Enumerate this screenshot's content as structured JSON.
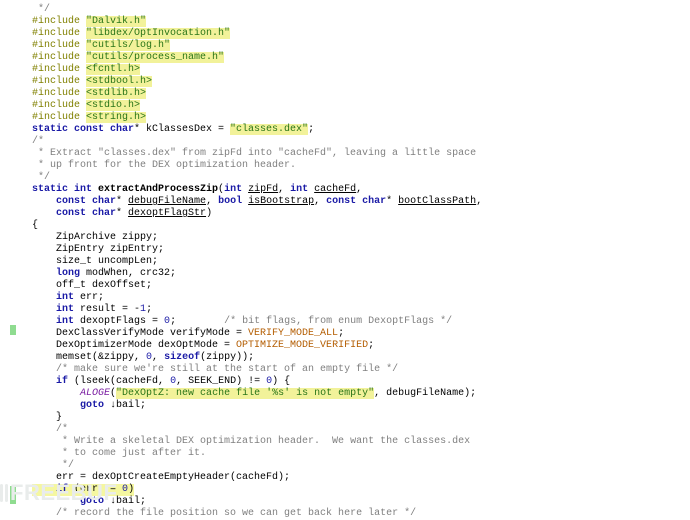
{
  "file": {
    "language": "C",
    "lines": [
      {
        "parts": [
          {
            "c": "cm",
            "t": " */"
          }
        ]
      },
      {
        "parts": [
          {
            "c": "pp",
            "t": "#include "
          },
          {
            "c": "inc",
            "t": "\"Dalvik.h\""
          }
        ]
      },
      {
        "parts": [
          {
            "c": "pp",
            "t": "#include "
          },
          {
            "c": "inc",
            "t": "\"libdex/OptInvocation.h\""
          }
        ]
      },
      {
        "parts": [
          {
            "c": "",
            "t": ""
          }
        ]
      },
      {
        "parts": [
          {
            "c": "pp",
            "t": "#include "
          },
          {
            "c": "inc",
            "t": "\"cutils/log.h\""
          }
        ]
      },
      {
        "parts": [
          {
            "c": "pp",
            "t": "#include "
          },
          {
            "c": "inc",
            "t": "\"cutils/process_name.h\""
          }
        ]
      },
      {
        "parts": [
          {
            "c": "",
            "t": ""
          }
        ]
      },
      {
        "parts": [
          {
            "c": "pp",
            "t": "#include "
          },
          {
            "c": "inc",
            "t": "<fcntl.h>"
          }
        ]
      },
      {
        "parts": [
          {
            "c": "pp",
            "t": "#include "
          },
          {
            "c": "inc",
            "t": "<stdbool.h>"
          }
        ]
      },
      {
        "parts": [
          {
            "c": "pp",
            "t": "#include "
          },
          {
            "c": "inc",
            "t": "<stdlib.h>"
          }
        ]
      },
      {
        "parts": [
          {
            "c": "pp",
            "t": "#include "
          },
          {
            "c": "inc",
            "t": "<stdio.h>"
          }
        ]
      },
      {
        "parts": [
          {
            "c": "pp",
            "t": "#include "
          },
          {
            "c": "inc",
            "t": "<string.h>"
          }
        ]
      },
      {
        "parts": [
          {
            "c": "",
            "t": ""
          }
        ]
      },
      {
        "parts": [
          {
            "c": "kw",
            "t": "static const char"
          },
          {
            "c": "",
            "t": "* kClassesDex = "
          },
          {
            "c": "str",
            "t": "\"classes.dex\""
          },
          {
            "c": "",
            "t": ";"
          }
        ]
      },
      {
        "parts": [
          {
            "c": "",
            "t": ""
          }
        ]
      },
      {
        "parts": [
          {
            "c": "",
            "t": ""
          }
        ]
      },
      {
        "parts": [
          {
            "c": "cm",
            "t": "/*"
          }
        ]
      },
      {
        "parts": [
          {
            "c": "cm",
            "t": " * Extract \"classes.dex\" from zipFd into \"cacheFd\", leaving a little space"
          }
        ]
      },
      {
        "parts": [
          {
            "c": "cm",
            "t": " * up front for the DEX optimization header."
          }
        ]
      },
      {
        "parts": [
          {
            "c": "cm",
            "t": " */"
          }
        ]
      },
      {
        "parts": [
          {
            "c": "kw",
            "t": "static int "
          },
          {
            "c": "fn",
            "t": "extractAndProcessZip"
          },
          {
            "c": "",
            "t": "("
          },
          {
            "c": "kw",
            "t": "int"
          },
          {
            "c": "",
            "t": " "
          },
          {
            "c": "param",
            "t": "zipFd"
          },
          {
            "c": "",
            "t": ", "
          },
          {
            "c": "kw",
            "t": "int"
          },
          {
            "c": "",
            "t": " "
          },
          {
            "c": "param",
            "t": "cacheFd"
          },
          {
            "c": "",
            "t": ","
          }
        ]
      },
      {
        "parts": [
          {
            "c": "",
            "t": "    "
          },
          {
            "c": "kw",
            "t": "const char"
          },
          {
            "c": "",
            "t": "* "
          },
          {
            "c": "param",
            "t": "debugFileName"
          },
          {
            "c": "",
            "t": ", "
          },
          {
            "c": "kw",
            "t": "bool"
          },
          {
            "c": "",
            "t": " "
          },
          {
            "c": "param",
            "t": "isBootstrap"
          },
          {
            "c": "",
            "t": ", "
          },
          {
            "c": "kw",
            "t": "const char"
          },
          {
            "c": "",
            "t": "* "
          },
          {
            "c": "param",
            "t": "bootClassPath"
          },
          {
            "c": "",
            "t": ","
          }
        ]
      },
      {
        "parts": [
          {
            "c": "",
            "t": "    "
          },
          {
            "c": "kw",
            "t": "const char"
          },
          {
            "c": "",
            "t": "* "
          },
          {
            "c": "param",
            "t": "dexoptFlagStr"
          },
          {
            "c": "",
            "t": ")"
          }
        ]
      },
      {
        "parts": [
          {
            "c": "",
            "t": "{"
          }
        ]
      },
      {
        "parts": [
          {
            "c": "",
            "t": "    ZipArchive zippy;"
          }
        ]
      },
      {
        "parts": [
          {
            "c": "",
            "t": "    ZipEntry zipEntry;"
          }
        ]
      },
      {
        "parts": [
          {
            "c": "",
            "t": "    size_t uncompLen;"
          }
        ]
      },
      {
        "parts": [
          {
            "c": "",
            "t": "    "
          },
          {
            "c": "kw",
            "t": "long"
          },
          {
            "c": "",
            "t": " modWhen, crc32;"
          }
        ]
      },
      {
        "parts": [
          {
            "c": "",
            "t": "    off_t dexOffset;"
          }
        ]
      },
      {
        "parts": [
          {
            "c": "",
            "t": "    "
          },
          {
            "c": "kw",
            "t": "int"
          },
          {
            "c": "",
            "t": " err;"
          }
        ]
      },
      {
        "parts": [
          {
            "c": "",
            "t": "    "
          },
          {
            "c": "kw",
            "t": "int"
          },
          {
            "c": "",
            "t": " result = -"
          },
          {
            "c": "num",
            "t": "1"
          },
          {
            "c": "",
            "t": ";"
          }
        ]
      },
      {
        "parts": [
          {
            "c": "",
            "t": "    "
          },
          {
            "c": "kw",
            "t": "int"
          },
          {
            "c": "",
            "t": " dexoptFlags = "
          },
          {
            "c": "num",
            "t": "0"
          },
          {
            "c": "",
            "t": ";        "
          },
          {
            "c": "cm",
            "t": "/* bit flags, from enum DexoptFlags */"
          }
        ]
      },
      {
        "parts": [
          {
            "c": "",
            "t": ""
          }
        ]
      },
      {
        "parts": [
          {
            "c": "",
            "t": "    DexClassVerifyMode verifyMode = "
          },
          {
            "c": "enumv",
            "t": "VERIFY_MODE_ALL"
          },
          {
            "c": "",
            "t": ";"
          }
        ]
      },
      {
        "parts": [
          {
            "c": "",
            "t": "    DexOptimizerMode dexOptMode = "
          },
          {
            "c": "enumv",
            "t": "OPTIMIZE_MODE_VERIFIED"
          },
          {
            "c": "",
            "t": ";"
          }
        ]
      },
      {
        "parts": [
          {
            "c": "",
            "t": ""
          }
        ]
      },
      {
        "parts": [
          {
            "c": "",
            "t": "    memset(&zippy, "
          },
          {
            "c": "num",
            "t": "0"
          },
          {
            "c": "",
            "t": ", "
          },
          {
            "c": "kw",
            "t": "sizeof"
          },
          {
            "c": "",
            "t": "(zippy));"
          }
        ]
      },
      {
        "parts": [
          {
            "c": "",
            "t": ""
          }
        ]
      },
      {
        "parts": [
          {
            "c": "",
            "t": "    "
          },
          {
            "c": "cm",
            "t": "/* make sure we're still at the start of an empty file */"
          }
        ]
      },
      {
        "parts": [
          {
            "c": "",
            "t": "    "
          },
          {
            "c": "kw",
            "t": "if"
          },
          {
            "c": "",
            "t": " (lseek(cacheFd, "
          },
          {
            "c": "num",
            "t": "0"
          },
          {
            "c": "",
            "t": ", SEEK_END) != "
          },
          {
            "c": "num",
            "t": "0"
          },
          {
            "c": "",
            "t": ") {"
          }
        ]
      },
      {
        "parts": [
          {
            "c": "",
            "t": "        "
          },
          {
            "c": "macro",
            "t": "ALOGE"
          },
          {
            "c": "",
            "t": "("
          },
          {
            "c": "str",
            "t": "\"DexOptZ: new cache file '%s' is not empty\""
          },
          {
            "c": "",
            "t": ", debugFileName);"
          }
        ]
      },
      {
        "parts": [
          {
            "c": "",
            "t": "        "
          },
          {
            "c": "kw",
            "t": "goto "
          },
          {
            "c": "",
            "t": "↓bail;"
          }
        ]
      },
      {
        "parts": [
          {
            "c": "",
            "t": "    }"
          }
        ]
      },
      {
        "parts": [
          {
            "c": "",
            "t": ""
          }
        ]
      },
      {
        "parts": [
          {
            "c": "",
            "t": "    "
          },
          {
            "c": "cm",
            "t": "/*"
          }
        ]
      },
      {
        "parts": [
          {
            "c": "",
            "t": "    "
          },
          {
            "c": "cm",
            "t": " * Write a skeletal DEX optimization header.  We want the classes.dex"
          }
        ]
      },
      {
        "parts": [
          {
            "c": "",
            "t": "    "
          },
          {
            "c": "cm",
            "t": " * to come just after it."
          }
        ]
      },
      {
        "parts": [
          {
            "c": "",
            "t": "    "
          },
          {
            "c": "cm",
            "t": " */"
          }
        ]
      },
      {
        "parts": [
          {
            "c": "",
            "t": "    err = dexOptCreateEmptyHeader(cacheFd);"
          }
        ]
      },
      {
        "parts": [
          {
            "c": "",
            "t": "    "
          },
          {
            "c": "kw",
            "t": "if"
          },
          {
            "c": "",
            "t": " (err != "
          },
          {
            "c": "num",
            "t": "0"
          },
          {
            "c": "",
            "t": ")"
          }
        ],
        "hl": true
      },
      {
        "parts": [
          {
            "c": "",
            "t": "        "
          },
          {
            "c": "kw",
            "t": "goto "
          },
          {
            "c": "",
            "t": "↓bail;"
          }
        ]
      },
      {
        "parts": [
          {
            "c": "",
            "t": ""
          }
        ]
      },
      {
        "parts": [
          {
            "c": "",
            "t": "    "
          },
          {
            "c": "cm",
            "t": "/* record the file position so we can get back here later */"
          }
        ]
      }
    ]
  },
  "watermark": "FREEBUF"
}
